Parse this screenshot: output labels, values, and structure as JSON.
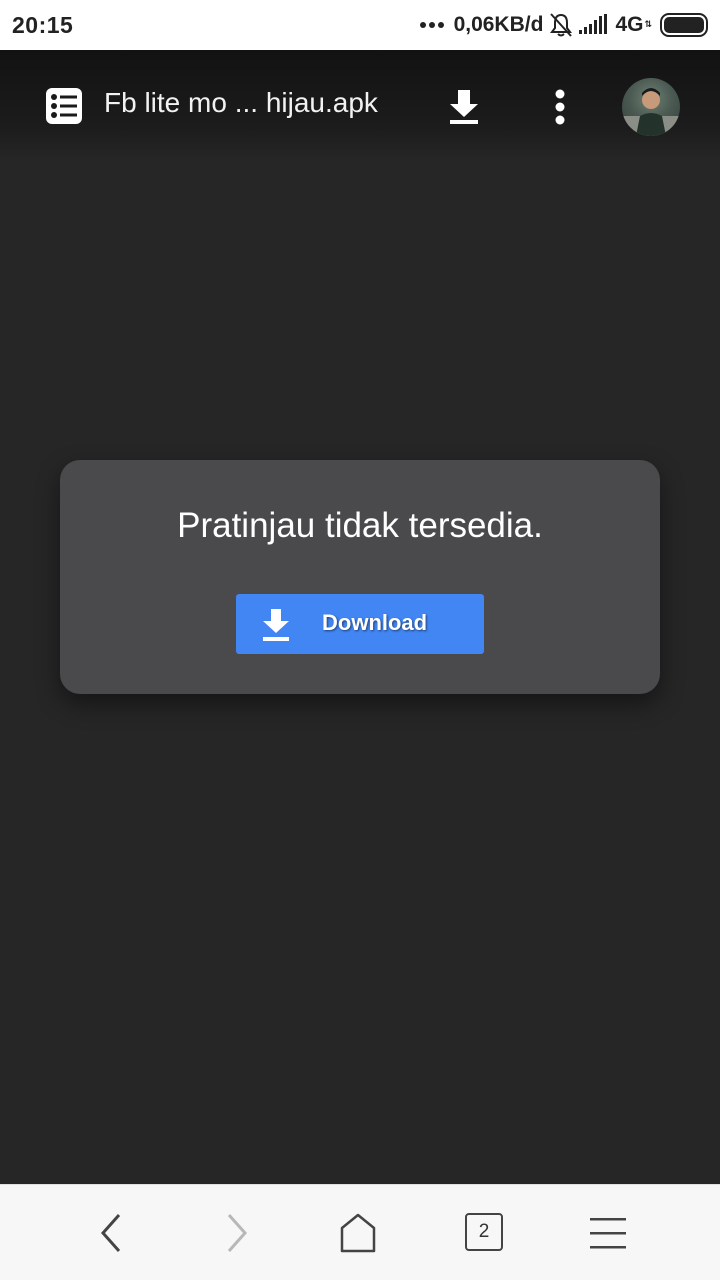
{
  "status_bar": {
    "time": "20:15",
    "network_speed": "0,06KB/d",
    "network_type": "4G",
    "icons": [
      "dots-icon",
      "muted-bell-icon",
      "signal-icon",
      "battery-icon"
    ]
  },
  "toolbar": {
    "file_title": "Fb lite mo ... hijau.apk",
    "icons": [
      "file-list-icon",
      "download-icon",
      "more-vert-icon",
      "avatar"
    ]
  },
  "preview": {
    "message": "Pratinjau tidak tersedia.",
    "download_label": "Download",
    "button_color": "#4286f4"
  },
  "bottom_nav": {
    "tab_count": "2",
    "icons": [
      "back-icon",
      "forward-icon",
      "home-icon",
      "tabs-icon",
      "menu-icon"
    ]
  },
  "colors": {
    "background": "#262626",
    "card": "#4a494c",
    "accent": "#4286f4"
  }
}
